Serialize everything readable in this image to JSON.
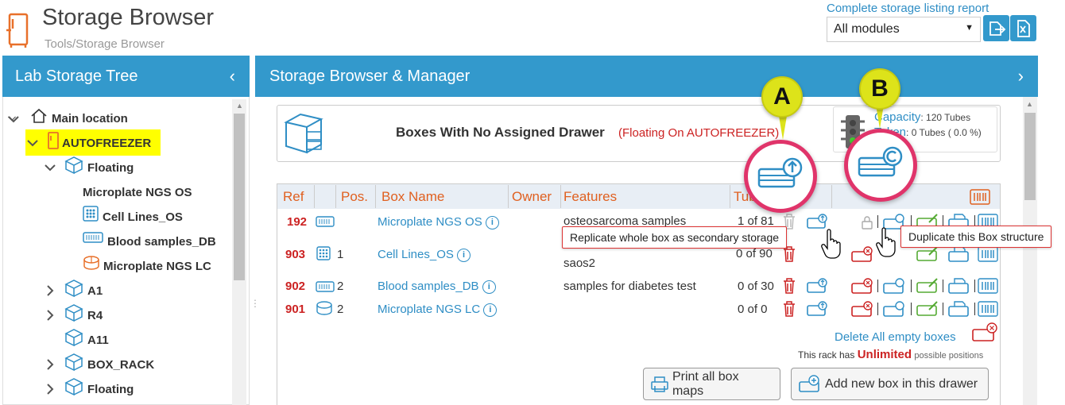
{
  "header": {
    "title": "Storage Browser",
    "breadcrumb": "Tools/Storage Browser",
    "report_link": "Complete storage listing report",
    "module_select": "All modules"
  },
  "left_panel": {
    "title": "Lab Storage Tree",
    "tree": [
      {
        "label": "Main location"
      },
      {
        "label": "AUTOFREEZER"
      },
      {
        "label": "Floating"
      },
      {
        "label": "Microplate NGS OS"
      },
      {
        "label": "Cell Lines_OS"
      },
      {
        "label": "Blood samples_DB"
      },
      {
        "label": "Microplate NGS LC"
      },
      {
        "label": "A1"
      },
      {
        "label": "R4"
      },
      {
        "label": "A11"
      },
      {
        "label": "BOX_RACK"
      },
      {
        "label": "Floating"
      }
    ]
  },
  "right_panel": {
    "title": "Storage Browser & Manager",
    "info_title": "Boxes With No Assigned Drawer",
    "info_subtitle": "(Floating On AUTOFREEZER)",
    "capacity_label": "Capacity",
    "capacity_value": ": 120 Tubes",
    "taken_label": "Taken",
    "taken_value": ": 0 Tubes ( 0.0 %)"
  },
  "table": {
    "headers": {
      "ref": "Ref",
      "pos": "Pos.",
      "name": "Box Name",
      "owner": "Owner",
      "features": "Features",
      "tubes": "Tub"
    },
    "rows": [
      {
        "ref": "192",
        "pos": "",
        "name": "Microplate NGS OS",
        "features": "osteosarcoma samples",
        "tubes": "1 of 81"
      },
      {
        "ref": "903",
        "pos": "1",
        "name": "Cell Lines_OS",
        "features": "saos2",
        "tubes": "0 of 90"
      },
      {
        "ref": "902",
        "pos": "2",
        "name": "Blood samples_DB",
        "features": "samples for diabetes test",
        "tubes": "0 of 30"
      },
      {
        "ref": "901",
        "pos": "2",
        "name": "Microplate NGS LC",
        "features": "",
        "tubes": "0 of 0"
      }
    ]
  },
  "footer": {
    "delete_empty": "Delete All empty boxes",
    "rack_note_prefix": "This rack has",
    "rack_note_value": "Unlimited",
    "rack_note_suffix": "possible positions",
    "print_maps": "Print all box maps",
    "add_box": "Add new box in this drawer"
  },
  "tooltips": {
    "replicate": "Replicate whole box as secondary storage",
    "duplicate": "Duplicate this Box structure"
  },
  "badges": {
    "a": "A",
    "b": "B"
  },
  "colors": {
    "accent": "#3399cc",
    "danger": "#cc2222",
    "link": "#2f8ec5",
    "callout": "#e0346a",
    "badge": "#dde31a"
  }
}
